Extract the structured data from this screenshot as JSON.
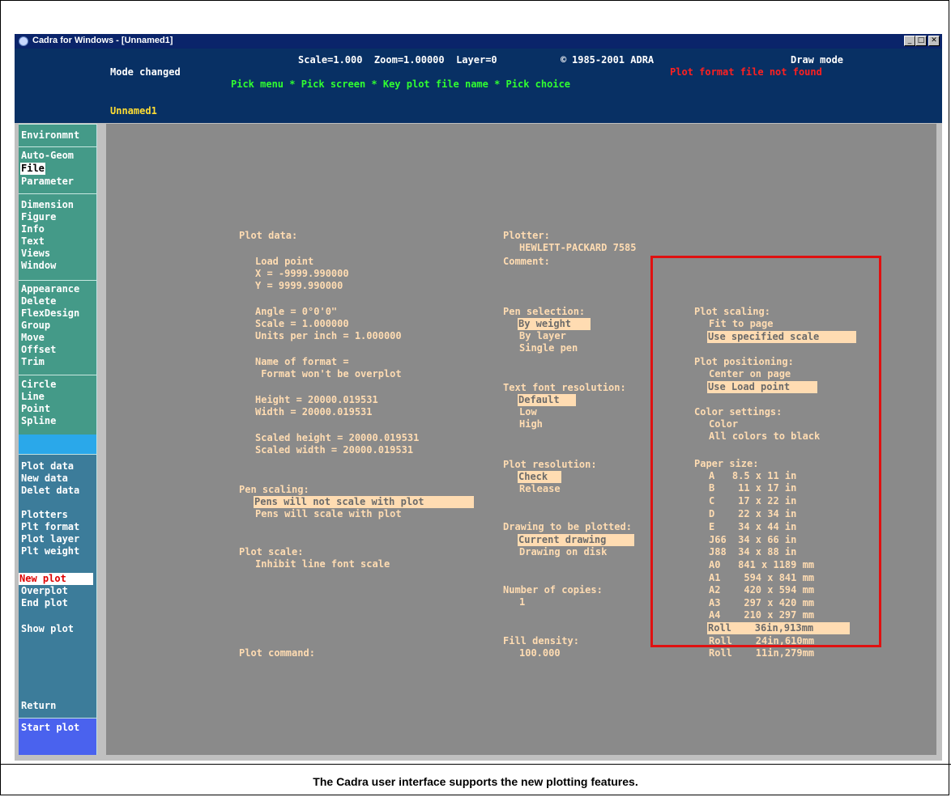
{
  "window": {
    "title": "Cadra for Windows - [Unnamed1]",
    "controls": {
      "minimize": "_",
      "maximize": "□",
      "close": "✕"
    }
  },
  "header": {
    "status_line": "Scale=1.000  Zoom=1.00000  Layer=0",
    "copyright": "1985-2001 ADRA",
    "copyright_symbol": "©",
    "mode": "Draw mode",
    "message": "Mode changed",
    "error": "Plot format file not found",
    "prompt": "Pick menu * Pick screen * Key plot file name * Pick choice",
    "filename": "Unnamed1"
  },
  "sidebar": {
    "group1": [
      "Environmnt"
    ],
    "group2": [
      "Auto-Geom",
      "File",
      "Parameter"
    ],
    "group3": [
      "Dimension",
      "Figure",
      "Info",
      "Text",
      "Views",
      "Window"
    ],
    "group4": [
      "Appearance",
      "Delete",
      "FlexDesign",
      "Group",
      "Move",
      "Offset",
      "Trim"
    ],
    "group5": [
      "Circle",
      "Line",
      "Point",
      "Spline"
    ],
    "group6": [
      "Plot data",
      "New data",
      "Delet data"
    ],
    "group7": [
      "Plotters",
      "Plt format",
      "Plot layer",
      "Plt weight"
    ],
    "group8": [
      "New plot",
      "Overplot",
      "End plot"
    ],
    "group9": [
      "Show plot"
    ],
    "return": "Return",
    "start": "Start plot"
  },
  "col1": {
    "plot_data_label": "Plot data:",
    "load_point": "Load point",
    "x": "X = -9999.990000",
    "y": "Y = 9999.990000",
    "angle": "Angle = 0°0'0\"",
    "scale": "Scale = 1.000000",
    "units": "Units per inch = 1.000000",
    "format_name": "Name of format =",
    "format_note": " Format won't be overplot",
    "height": "Height = 20000.019531",
    "width": "Width = 20000.019531",
    "scaled_height": "Scaled height = 20000.019531",
    "scaled_width": "Scaled width = 20000.019531",
    "pen_scaling_label": "Pen scaling:",
    "pen_scaling_opt1": "Pens will not scale with plot",
    "pen_scaling_opt2": "Pens will scale with plot",
    "plot_scale_label": "Plot scale:",
    "plot_scale_opt": "Inhibit line font scale",
    "plot_command_label": "Plot command:"
  },
  "col2": {
    "plotter_label": "Plotter:",
    "plotter_name": "HEWLETT-PACKARD 7585",
    "comment_label": "Comment:",
    "pen_selection_label": "Pen selection:",
    "pen_sel_opts": [
      "By weight",
      "By layer",
      "Single pen"
    ],
    "text_font_label": "Text font resolution:",
    "text_font_opts": [
      "Default",
      "Low",
      "High"
    ],
    "plot_res_label": "Plot resolution:",
    "plot_res_opts": [
      "Check",
      "Release"
    ],
    "drawing_label": "Drawing to be plotted:",
    "drawing_opts": [
      "Current drawing",
      "Drawing on disk"
    ],
    "copies_label": "Number of copies:",
    "copies_value": "1",
    "fill_label": "Fill density:",
    "fill_value": "100.000"
  },
  "col3": {
    "scaling_label": "Plot scaling:",
    "scaling_opts": [
      "Fit to page",
      "Use specified scale"
    ],
    "positioning_label": "Plot positioning:",
    "positioning_opts": [
      "Center on page",
      "Use Load point"
    ],
    "color_label": "Color settings:",
    "color_opts": [
      "Color",
      "All colors to black"
    ],
    "paper_label": "Paper size:",
    "paper_sizes": [
      "A   8.5 x 11 in",
      "B    11 x 17 in",
      "C    17 x 22 in",
      "D    22 x 34 in",
      "E    34 x 44 in",
      "J66  34 x 66 in",
      "J88  34 x 88 in",
      "A0   841 x 1189 mm",
      "A1    594 x 841 mm",
      "A2    420 x 594 mm",
      "A3    297 x 420 mm",
      "A4    210 x 297 mm",
      "Roll    36in,913mm",
      "Roll    24in,610mm",
      "Roll    11in,279mm"
    ]
  },
  "highlight_color": "#e01010",
  "caption": "The Cadra user interface supports the new plotting features."
}
